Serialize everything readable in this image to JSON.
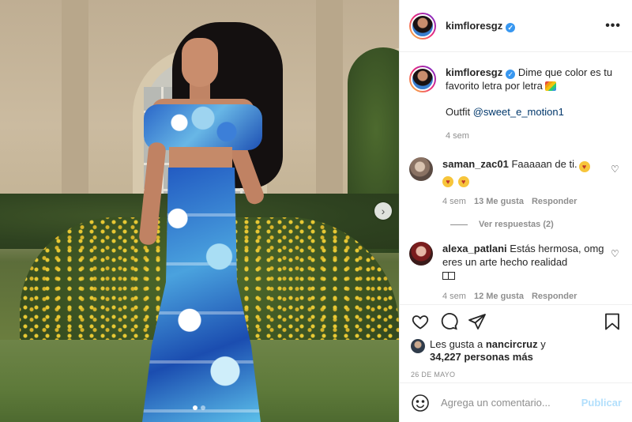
{
  "post": {
    "image_alt": "photo",
    "carousel_dots": 2,
    "active_dot": 1
  },
  "header": {
    "username": "kimfloresgz",
    "verified_icon": "verified-badge-icon",
    "more_icon": "more-options-icon"
  },
  "caption": {
    "username": "kimfloresgz",
    "text": "Dime que color es tu favorito letra por letra",
    "emoji": "rainbow-emoji",
    "outfit_label": "Outfit",
    "mention": "@sweet_e_motion1",
    "time": "4 sem"
  },
  "comments": [
    {
      "username": "saman_zac01",
      "text": "Faaaaan de ti.",
      "emojis": [
        "smiling-cat-heart-eyes-emoji",
        "smiling-cat-heart-eyes-emoji",
        "smiling-cat-heart-eyes-emoji"
      ],
      "time": "4 sem",
      "likes": "13 Me gusta",
      "reply": "Responder",
      "view_replies": "Ver respuestas (2)"
    },
    {
      "username": "alexa_patlani",
      "text": "Estás hermosa, omg eres un arte hecho realidad",
      "time": "4 sem",
      "likes": "12 Me gusta",
      "reply": "Responder"
    }
  ],
  "actions": {
    "like_icon": "heart-icon",
    "comment_icon": "comment-icon",
    "share_icon": "paper-plane-icon",
    "save_icon": "bookmark-icon"
  },
  "likes": {
    "prefix": "Les gusta a",
    "user": "nancircruz",
    "connector": "y",
    "count": "34,227 personas más"
  },
  "date": "26 DE MAYO",
  "add_comment": {
    "placeholder": "Agrega un comentario...",
    "publish_label": "Publicar",
    "emoji_icon": "smiley-icon"
  },
  "colors": {
    "verified": "#3897f0",
    "mention": "#00376b",
    "muted": "#8e8e8e",
    "publish_disabled": "#b2dffc"
  }
}
